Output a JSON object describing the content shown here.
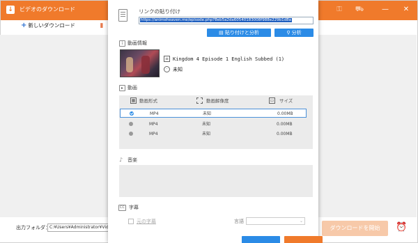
{
  "app": {
    "title": "ビデオのダウンロード",
    "new_download": "新しいダウンロード",
    "output_folder_label": "出力フォルダ：",
    "output_folder_value": "C:¥Users¥Administrator¥Videos",
    "start_button": "ダウンロードを開始"
  },
  "dialog": {
    "paste_label": "リンクの貼り付け",
    "url": "https://animeheaven.me/episode.php?8eb5a2da60540183008f988e229b1d8a",
    "paste_analyze_button": "貼り付けと分析",
    "analyze_button": "分析",
    "video_info_label": "動画情報",
    "video_title": "Kingdom 4 Episode 1 English Subbed (1)",
    "video_duration": "未知",
    "video_section_label": "動画",
    "columns": {
      "format": "動画形式",
      "resolution": "動画解像度",
      "size": "サイズ"
    },
    "rows": [
      {
        "format": "MP4",
        "resolution": "未知",
        "size": "0.00MB",
        "selected": true
      },
      {
        "format": "MP4",
        "resolution": "未知",
        "size": "0.00MB",
        "selected": false
      },
      {
        "format": "MP4",
        "resolution": "未知",
        "size": "0.00MB",
        "selected": false
      }
    ],
    "audio_section_label": "音楽",
    "subtitle_section_label": "字幕",
    "original_subtitle": "元の字幕",
    "language_label": "言語"
  },
  "colors": {
    "brand": "#f07a2b",
    "accent": "#2b8be6"
  }
}
